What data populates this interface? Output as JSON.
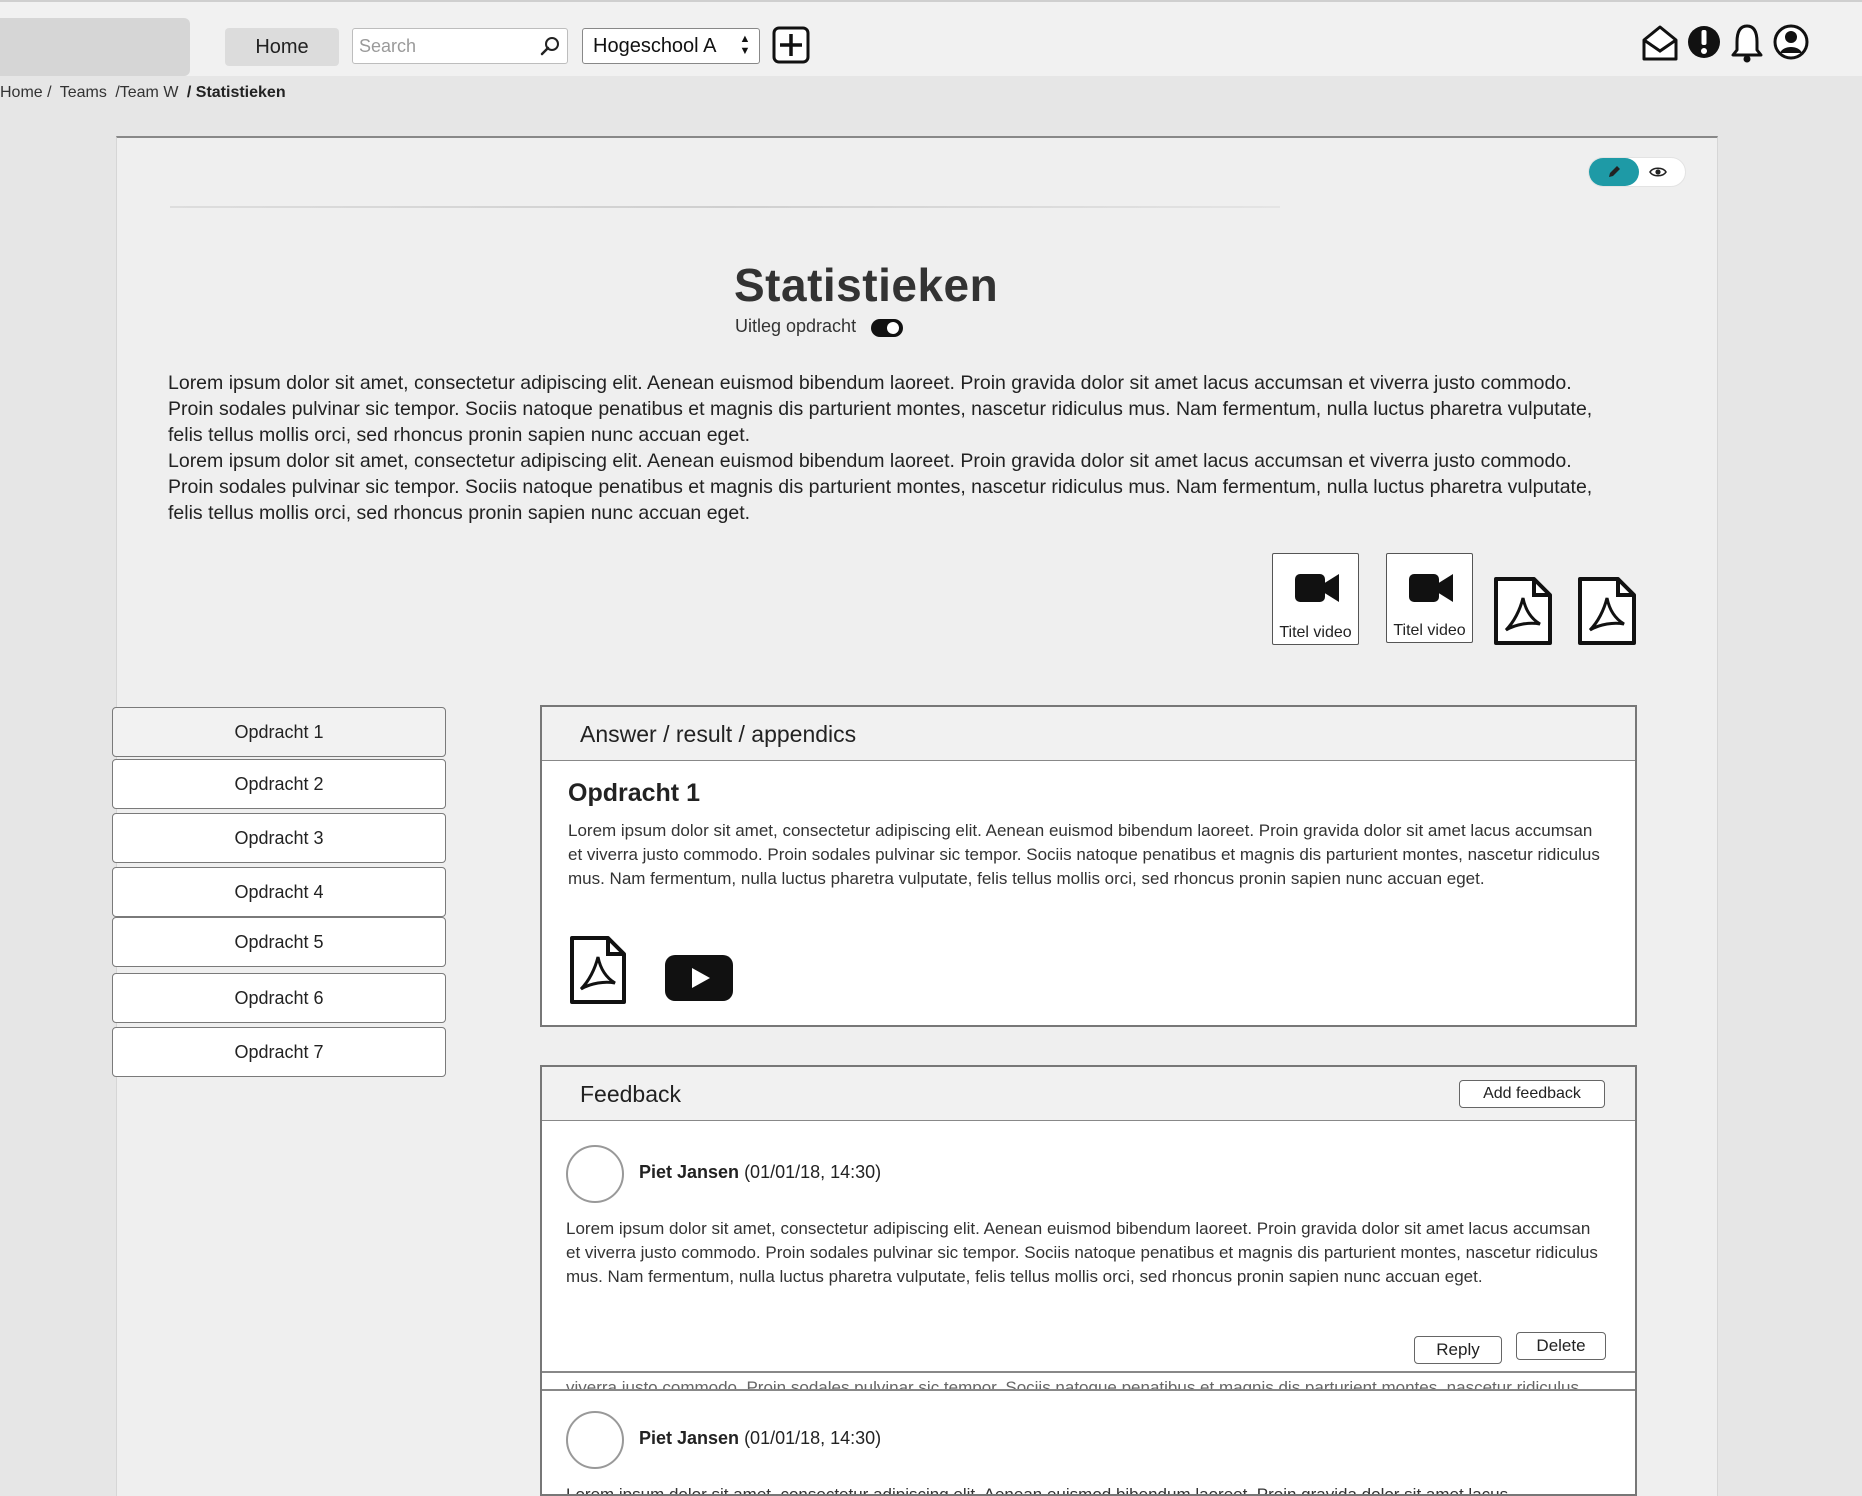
{
  "topbar": {
    "home_label": "Home",
    "search_placeholder": "Search",
    "school_selected": "Hogeschool A",
    "icons": [
      "search-icon",
      "add-icon",
      "mail-icon",
      "alert-icon",
      "bell-icon",
      "user-icon"
    ]
  },
  "breadcrumb": [
    "Home /",
    "Teams",
    "/Team W",
    "/ Statistieken"
  ],
  "page": {
    "title": "Statistieken",
    "uitleg_label": "Uitleg opdracht",
    "intro": [
      "Lorem ipsum dolor sit amet, consectetur adipiscing elit. Aenean euismod bibendum laoreet. Proin gravida dolor sit amet lacus accumsan et viverra justo commodo. Proin sodales pulvinar sic tempor. Sociis natoque penatibus et magnis dis parturient montes, nascetur ridiculus mus. Nam fermentum, nulla luctus pharetra vulputate, felis tellus mollis orci, sed rhoncus pronin sapien nunc accuan eget.",
      "Lorem ipsum dolor sit amet, consectetur adipiscing elit. Aenean euismod bibendum laoreet. Proin gravida dolor sit amet lacus accumsan et viverra justo commodo. Proin sodales pulvinar sic tempor. Sociis natoque penatibus et magnis dis parturient montes, nascetur ridiculus mus. Nam fermentum, nulla luctus pharetra vulputate, felis tellus mollis orci, sed rhoncus pronin sapien nunc accuan eget."
    ],
    "media": [
      {
        "caption": "Titel video"
      },
      {
        "caption": "Titel video"
      }
    ]
  },
  "sidebar": {
    "items": [
      "Opdracht 1",
      "Opdracht 2",
      "Opdracht 3",
      "Opdracht 4",
      "Opdracht 5",
      "Opdracht 6",
      "Opdracht 7"
    ]
  },
  "answer": {
    "header": "Answer / result / appendics",
    "title": "Opdracht 1",
    "text": "Lorem ipsum dolor sit amet, consectetur adipiscing elit. Aenean euismod bibendum laoreet. Proin gravida dolor sit amet lacus accumsan et viverra justo commodo. Proin sodales pulvinar sic tempor. Sociis natoque penatibus et magnis dis parturient montes, nascetur ridiculus mus. Nam fermentum, nulla luctus pharetra vulputate, felis tellus mollis orci, sed rhoncus pronin sapien nunc accuan eget."
  },
  "feedback": {
    "header": "Feedback",
    "add_label": "Add feedback",
    "reply_label": "Reply",
    "delete_label": "Delete",
    "ghost_text": "viverra justo commodo. Proin sodales pulvinar sic tempor. Sociis natoque penatibus et magnis dis parturient montes, nascetur ridiculus mus.",
    "items": [
      {
        "author": "Piet Jansen",
        "date": "(01/01/18, 14:30)",
        "text": "Lorem ipsum dolor sit amet, consectetur adipiscing elit. Aenean euismod bibendum laoreet. Proin gravida dolor sit amet lacus accumsan et viverra justo commodo. Proin sodales pulvinar sic tempor. Sociis natoque penatibus et magnis dis parturient montes, nascetur ridiculus mus. Nam fermentum, nulla luctus pharetra vulputate, felis tellus mollis orci, sed rhoncus pronin sapien nunc accuan eget."
      },
      {
        "author": "Piet Jansen",
        "date": "(01/01/18, 14:30)",
        "text": "Lorem ipsum dolor sit amet, consectetur adipiscing elit. Aenean euismod bibendum laoreet. Proin gravida dolor sit amet lacus"
      }
    ]
  },
  "colors": {
    "accent": "#1e9aa6",
    "background": "#e6e6e6",
    "panel": "#efefef"
  }
}
